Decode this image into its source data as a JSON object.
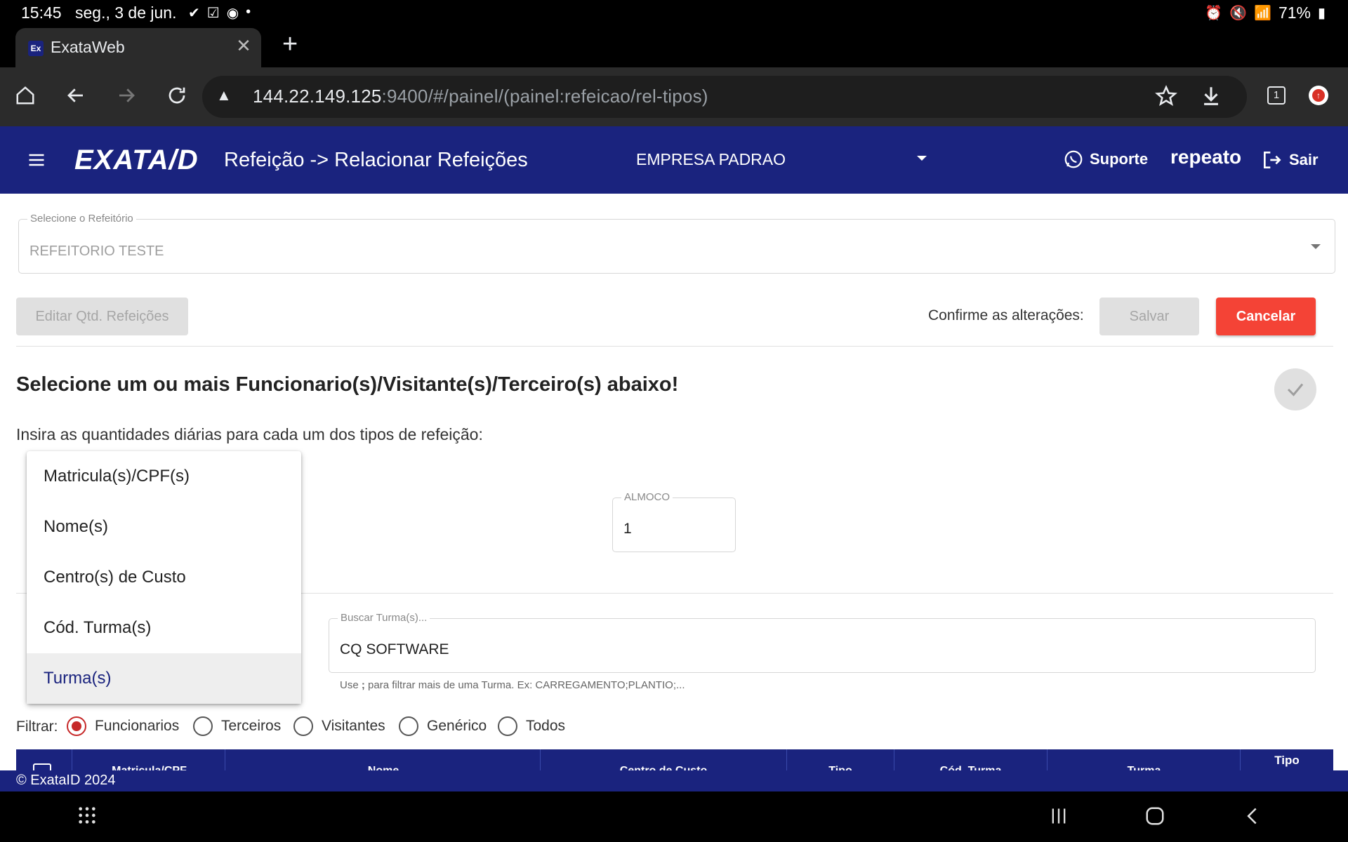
{
  "status_bar": {
    "time": "15:45",
    "date": "seg., 3 de jun.",
    "battery": "71%"
  },
  "browser": {
    "tab_title": "ExataWeb",
    "favicon_text": "Ex",
    "url_host": "144.22.149.125",
    "url_rest": ":9400/#/painel/(painel:refeicao/rel-tipos)",
    "tab_count": "1"
  },
  "header": {
    "logo": "EXATA/D",
    "title": "Refeição -> Relacionar Refeições",
    "company": "EMPRESA PADRAO",
    "support": "Suporte",
    "user": "repeato",
    "logout": "Sair"
  },
  "refeitorio": {
    "label": "Selecione o Refeitório",
    "value": "REFEITORIO TESTE"
  },
  "actions": {
    "edit_label": "Editar Qtd. Refeições",
    "confirm_label": "Confirme as alterações:",
    "save_label": "Salvar",
    "cancel_label": "Cancelar"
  },
  "section": {
    "heading": "Selecione um ou mais Funcionario(s)/Visitante(s)/Terceiro(s) abaixo!",
    "subheading": "Insira as quantidades diárias para cada um dos tipos de refeição:"
  },
  "almoco": {
    "label": "ALMOCO",
    "value": "1"
  },
  "search": {
    "label": "Buscar Turma(s)...",
    "value": "CQ SOFTWARE",
    "hint_prefix": "Use ",
    "hint_sep": ";",
    "hint_suffix": " para filtrar mais de uma Turma. Ex: CARREGAMENTO;PLANTIO;..."
  },
  "dropdown": {
    "items": [
      {
        "label": "Matricula(s)/CPF(s)",
        "selected": false
      },
      {
        "label": "Nome(s)",
        "selected": false
      },
      {
        "label": "Centro(s) de Custo",
        "selected": false
      },
      {
        "label": "Cód. Turma(s)",
        "selected": false
      },
      {
        "label": "Turma(s)",
        "selected": true
      }
    ]
  },
  "filter": {
    "label": "Filtrar:",
    "options": [
      "Funcionarios",
      "Terceiros",
      "Visitantes",
      "Genérico",
      "Todos"
    ],
    "selected": "Funcionarios"
  },
  "table": {
    "headers": [
      "Matricula/CPF",
      "Nome",
      "Centro de Custo",
      "Tipo",
      "Cód. Turma",
      "Turma",
      "Tipo"
    ]
  },
  "footer": {
    "text": "© ExataID 2024"
  },
  "colors": {
    "primary": "#1a237e",
    "danger": "#f44336",
    "radio_checked": "#c62828"
  }
}
